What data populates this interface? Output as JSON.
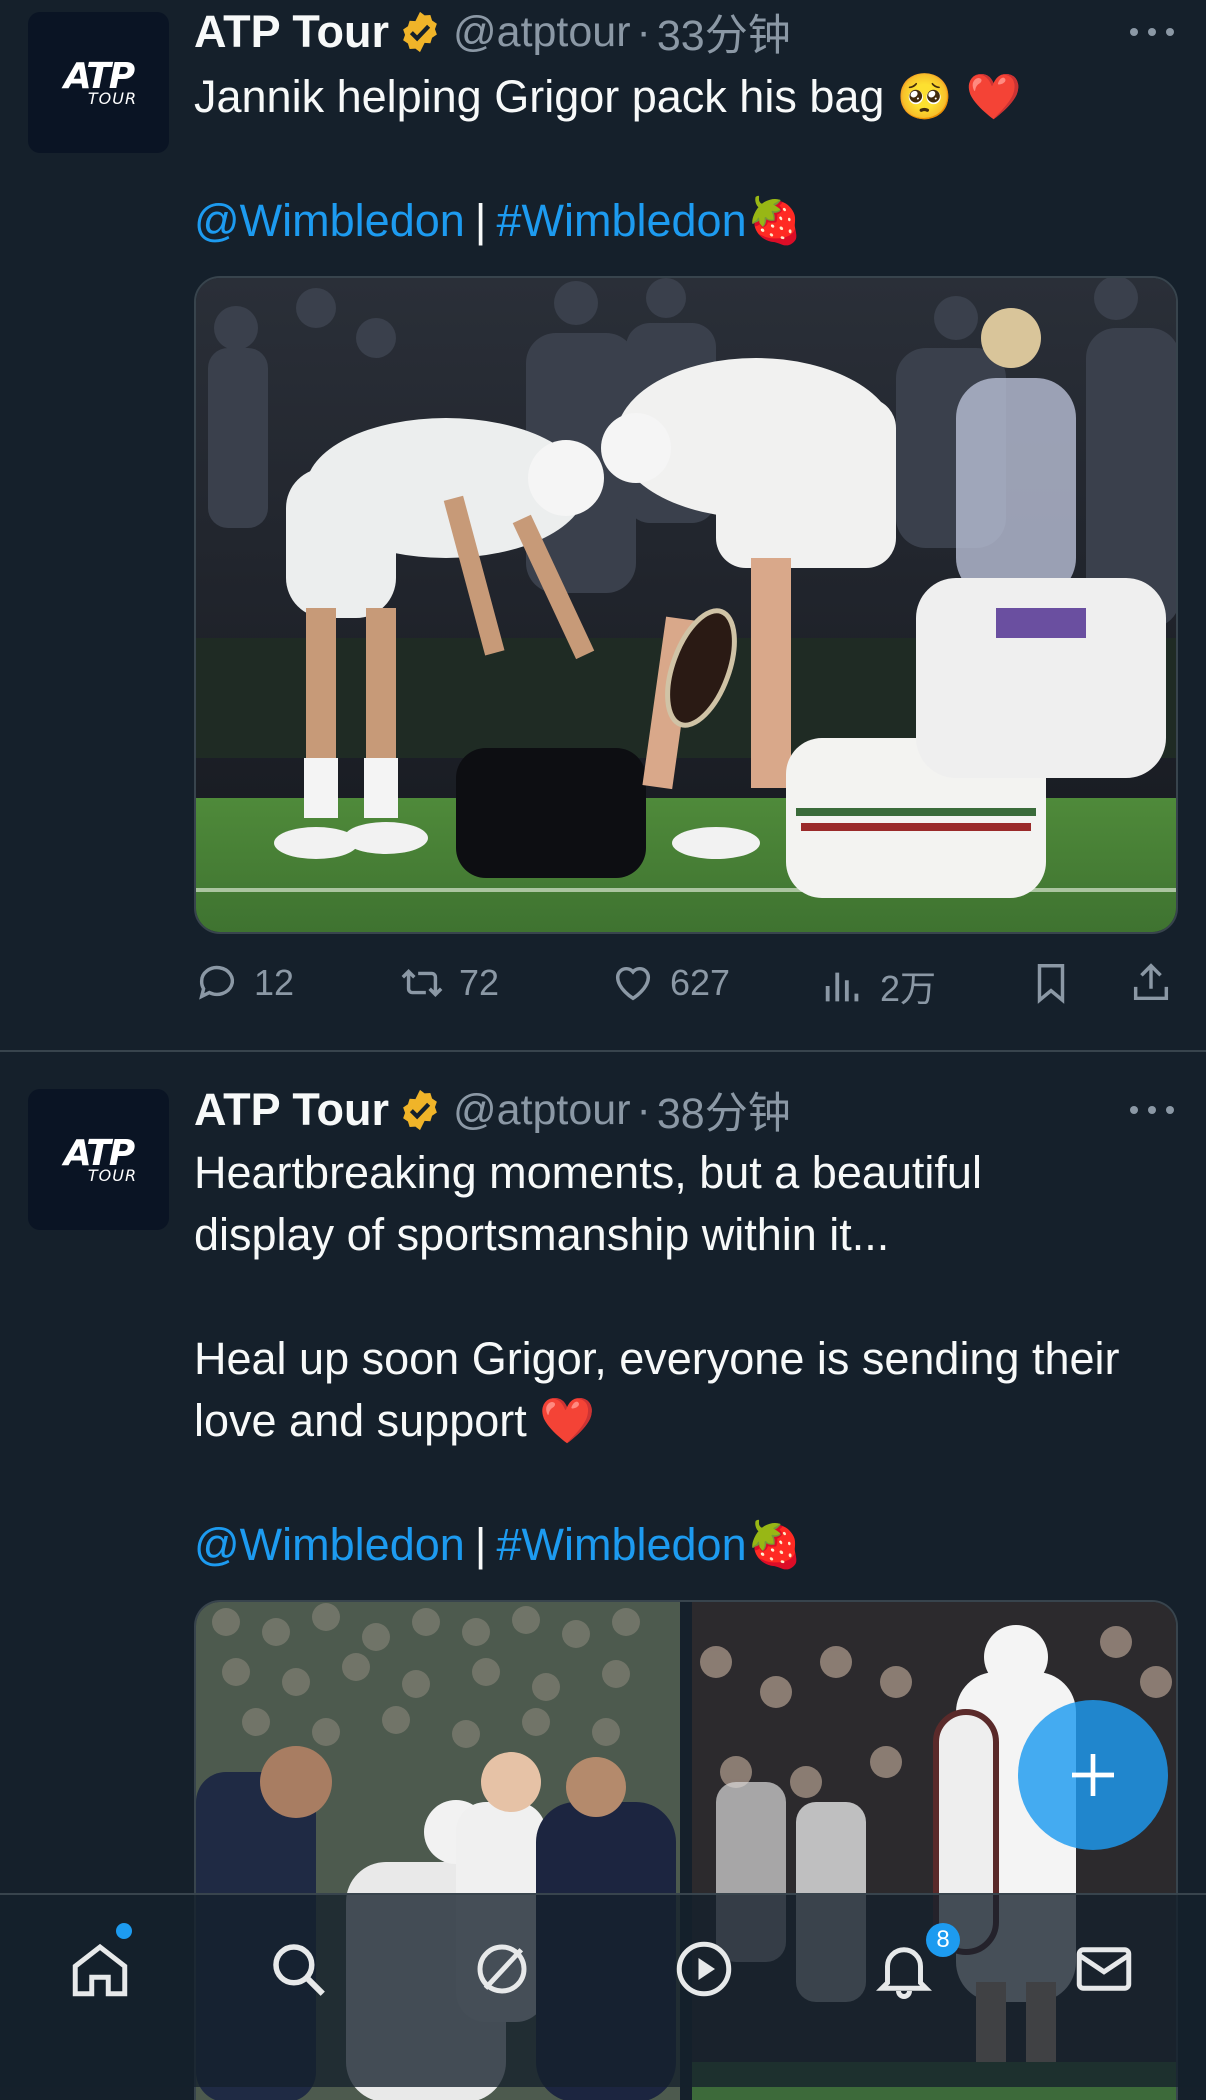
{
  "tweets": [
    {
      "author": {
        "name": "ATP Tour",
        "handle": "@atptour",
        "verified": true,
        "avatar_text_top": "ATP",
        "avatar_text_bottom": "TOUR"
      },
      "separator": "·",
      "time": "33分钟",
      "text_lines": [
        "Jannik helping Grigor pack his bag 🥺 ❤️"
      ],
      "mention": "@Wimbledon",
      "tag_separator": "|",
      "hashtag": "#Wimbledon",
      "hashtag_emoji": "🍓",
      "media": {
        "description": "photo",
        "count": 1
      },
      "stats": {
        "replies": "12",
        "retweets": "72",
        "likes": "627",
        "views": "2万"
      }
    },
    {
      "author": {
        "name": "ATP Tour",
        "handle": "@atptour",
        "verified": true,
        "avatar_text_top": "ATP",
        "avatar_text_bottom": "TOUR"
      },
      "separator": "·",
      "time": "38分钟",
      "text_lines": [
        "Heartbreaking moments, but a beautiful",
        "display of sportsmanship within it...",
        "",
        "Heal up soon Grigor, everyone is sending their",
        "love and support ❤️"
      ],
      "mention": "@Wimbledon",
      "tag_separator": "|",
      "hashtag": "#Wimbledon",
      "hashtag_emoji": "🍓",
      "media": {
        "count": 2
      }
    }
  ],
  "bottom_nav": {
    "items": [
      "home-icon",
      "search-icon",
      "grok-icon",
      "video-icon",
      "notifications-icon",
      "messages-icon"
    ],
    "notification_badge": "8"
  },
  "colors": {
    "background": "#15202b",
    "accent": "#1d9bf0",
    "muted": "#8b98a5",
    "verified": "#f0b429",
    "divider": "#38444d"
  }
}
